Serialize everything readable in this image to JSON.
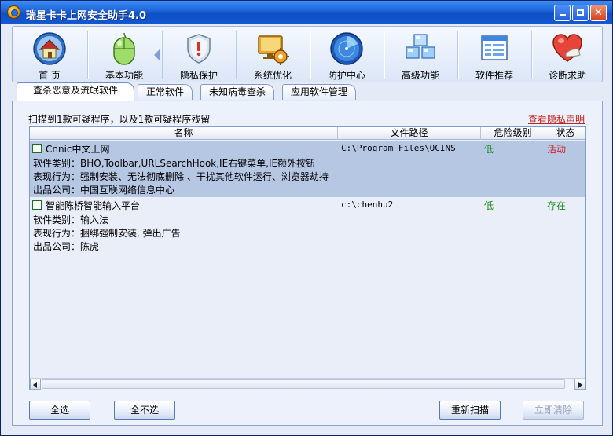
{
  "window": {
    "title": "瑞星卡卡上网安全助手4.0"
  },
  "toolbar": {
    "items": [
      {
        "label": "首 页",
        "icon": "home-icon"
      },
      {
        "label": "基本功能",
        "icon": "mouse-icon"
      },
      {
        "label": "隐私保护",
        "icon": "shield-icon"
      },
      {
        "label": "系统优化",
        "icon": "monitor-gear-icon"
      },
      {
        "label": "防护中心",
        "icon": "radar-icon"
      },
      {
        "label": "高级功能",
        "icon": "cubes-icon"
      },
      {
        "label": "软件推荐",
        "icon": "window-list-icon"
      },
      {
        "label": "诊断求助",
        "icon": "heart-hand-icon"
      }
    ]
  },
  "tabs": [
    {
      "label": "查杀恶意及流氓软件",
      "active": true
    },
    {
      "label": "正常软件",
      "active": false
    },
    {
      "label": "未知病毒查杀",
      "active": false
    },
    {
      "label": "应用软件管理",
      "active": false
    }
  ],
  "panel": {
    "summary": "扫描到1款可疑程序，以及1款可疑程序残留",
    "privacy_link": "查看隐私声明",
    "columns": [
      "名称",
      "文件路径",
      "危险级别",
      "状态"
    ],
    "rows": [
      {
        "name": "Cnnic中文上网",
        "path": "C:\\Program Files\\OCINS",
        "risk": "低",
        "state": "活动",
        "state_color": "#d0241c",
        "category": "软件类别：BHO,Toolbar,URLSearchHook,IE右键菜单,IE额外按钮",
        "behavior": "表现行为：强制安装、无法彻底删除 、干扰其他软件运行、浏览器劫持",
        "company": "出品公司：中国互联网络信息中心",
        "selected": true
      },
      {
        "name": "智能陈桥智能输入平台",
        "path": "c:\\chenhu2",
        "risk": "低",
        "state": "存在",
        "state_color": "#1a8a1a",
        "category": "软件类别：输入法",
        "behavior": "表现行为：捆绑强制安装, 弹出广告",
        "company": "出品公司：陈虎",
        "selected": false
      }
    ]
  },
  "buttons": {
    "select_all": "全选",
    "select_none": "全不选",
    "rescan": "重新扫描",
    "clean_now": "立即清除"
  },
  "colors": {
    "title_bar": "#1c63d8",
    "risk_low": "#1a8a1a",
    "link_red": "#c0241f",
    "selection": "#b6c7e4"
  }
}
